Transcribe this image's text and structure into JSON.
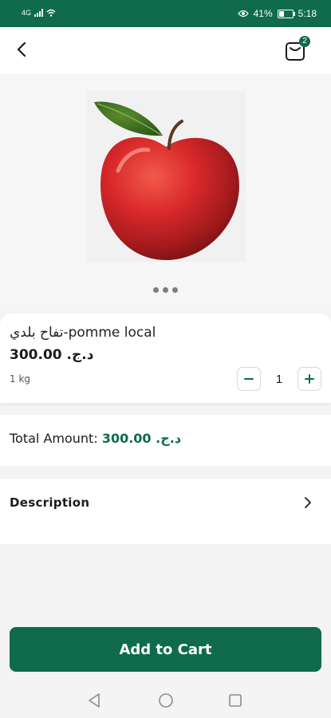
{
  "status_bar": {
    "network": "4G",
    "battery": "41%",
    "battery_level": 0.41,
    "time": "5:18"
  },
  "header": {
    "back_icon": "back-arrow-icon",
    "cart_icon": "shopping-bag-icon",
    "cart_count": "2"
  },
  "gallery": {
    "image": "apple",
    "dots": 3
  },
  "product": {
    "name": "تفاح بلدي-pomme local",
    "price": "د.ج. 300.00",
    "unit": "1 kg",
    "quantity": "1"
  },
  "total": {
    "label": "Total Amount: ",
    "amount": "300.00 .د.ج"
  },
  "description": {
    "label": "Description"
  },
  "cta": {
    "add_to_cart": "Add to Cart"
  },
  "colors": {
    "primary": "#0f6b4c",
    "background": "#f4f4f4"
  }
}
